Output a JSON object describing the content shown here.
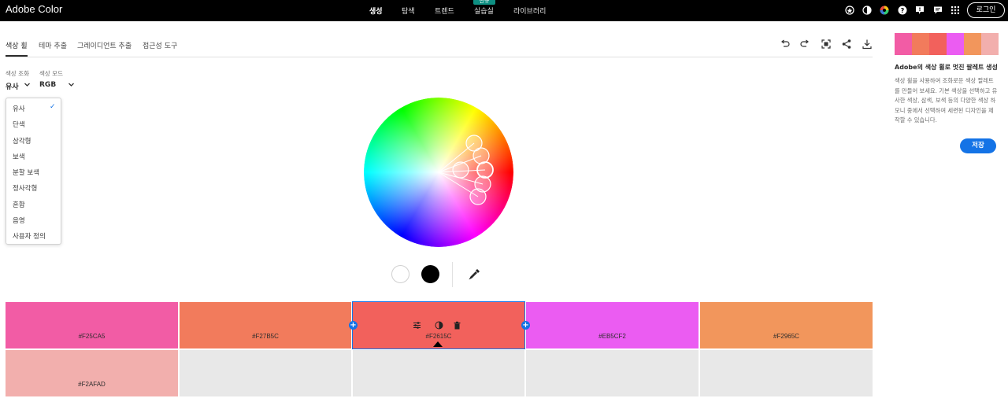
{
  "app": {
    "title": "Adobe Color"
  },
  "nav": {
    "items": [
      "생성",
      "탐색",
      "트렌드",
      "실습실",
      "라이브러리"
    ],
    "active": "생성",
    "new_badge": "신규",
    "login": "로그인"
  },
  "topbar_icons": [
    "plugin-icon",
    "contrast-icon",
    "color-wheel-icon",
    "help-icon",
    "feedback-icon",
    "chat-icon",
    "apps-grid-icon"
  ],
  "tabs": [
    "색상 휠",
    "테마 추출",
    "그레이디언트 추출",
    "접근성 도구"
  ],
  "active_tab": "색상 휠",
  "tools": [
    "undo-icon",
    "redo-icon",
    "fullscreen-icon",
    "share-icon",
    "download-icon"
  ],
  "controls": {
    "harmony_label": "색상 조화",
    "harmony_value": "유사",
    "mode_label": "색상 모드",
    "mode_value": "RGB"
  },
  "harmony_options": [
    "유사",
    "단색",
    "삼각형",
    "보색",
    "분할 보색",
    "정사각형",
    "혼합",
    "음영",
    "사용자 정의"
  ],
  "selected_option": "유사",
  "swatches": [
    {
      "hex": "#F25CA5",
      "color": "#F25CA5"
    },
    {
      "hex": "#F27B5C",
      "color": "#F27B5C"
    },
    {
      "hex": "#F2615C",
      "color": "#F2615C"
    },
    {
      "hex": "#EB5CF2",
      "color": "#EB5CF2"
    },
    {
      "hex": "#F2965C",
      "color": "#F2965C"
    },
    {
      "hex": "#F2AFAD",
      "color": "#F2AFAD"
    }
  ],
  "selected_swatch": "#F2615C",
  "side_panel": {
    "palette": [
      "#F25CA5",
      "#F27B5C",
      "#F2615C",
      "#EB5CF2",
      "#F2965C",
      "#F2AFAD"
    ],
    "title": "Adobe의 색상 휠로 멋진 팔레트 생성",
    "description": "색상 휠을 사용하여 조화로운 색상 팔레트를 만들어 보세요. 기본 색상을 선택하고 유사한 색상, 삼색, 보색 등의 다양한 색상 하모니 중에서 선택하여 세련된 디자인을 제작할 수 있습니다.",
    "save": "저장"
  },
  "accent_color": "#1473e6"
}
